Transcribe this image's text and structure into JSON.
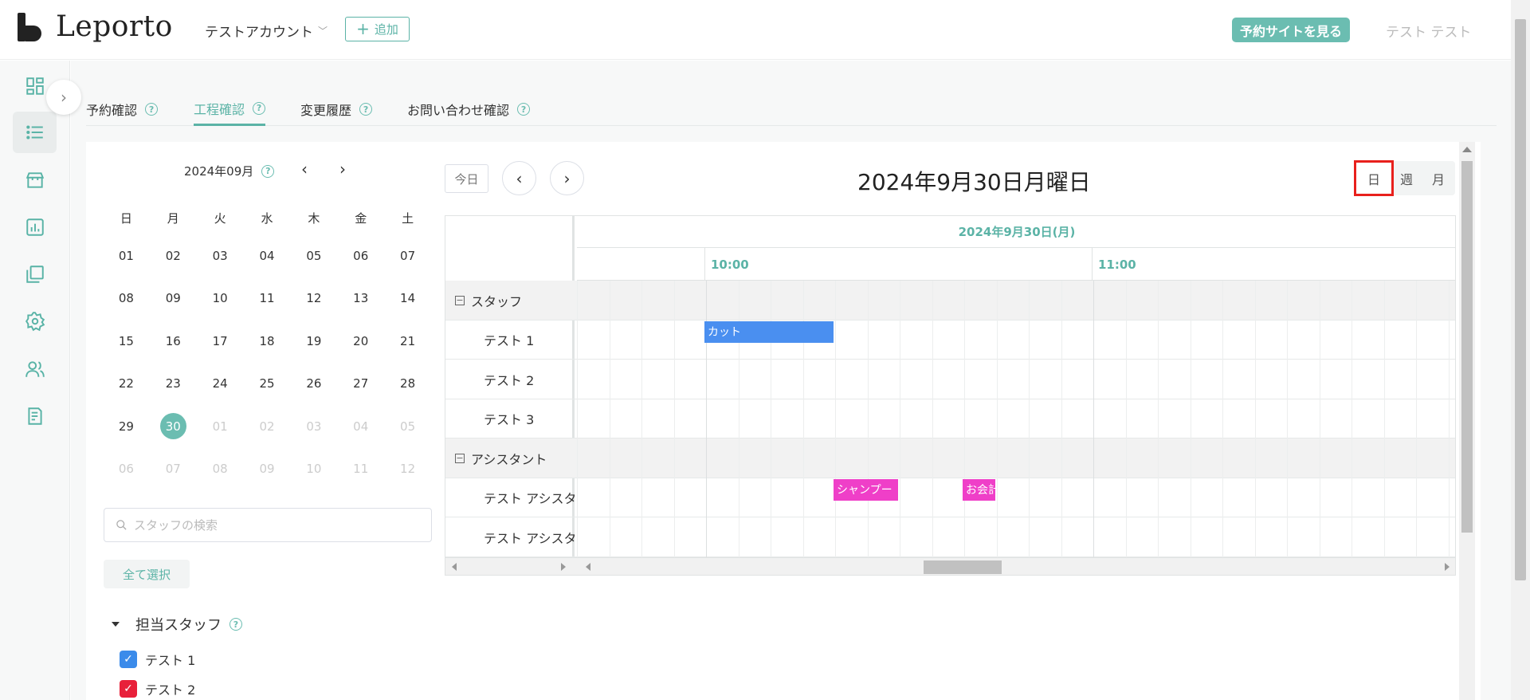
{
  "header": {
    "logo_text": "Leporto",
    "account_label": "テストアカウント",
    "add_label": "追加",
    "site_button_label": "予約サイトを見る",
    "user_name": "テスト テスト"
  },
  "sidebar": {
    "items": [
      {
        "icon": "dashboard-icon"
      },
      {
        "icon": "list-icon",
        "active": true
      },
      {
        "icon": "store-icon"
      },
      {
        "icon": "chart-icon"
      },
      {
        "icon": "copy-icon"
      },
      {
        "icon": "gear-icon"
      },
      {
        "icon": "users-icon"
      },
      {
        "icon": "report-icon"
      }
    ]
  },
  "tabs": [
    {
      "label": "予約確認"
    },
    {
      "label": "工程確認",
      "active": true
    },
    {
      "label": "変更履歴"
    },
    {
      "label": "お問い合わせ確認"
    }
  ],
  "mini_calendar": {
    "month_label": "2024年09月",
    "weekdays": [
      "日",
      "月",
      "火",
      "水",
      "木",
      "金",
      "土"
    ],
    "weeks": [
      [
        "01",
        "02",
        "03",
        "04",
        "05",
        "06",
        "07"
      ],
      [
        "08",
        "09",
        "10",
        "11",
        "12",
        "13",
        "14"
      ],
      [
        "15",
        "16",
        "17",
        "18",
        "19",
        "20",
        "21"
      ],
      [
        "22",
        "23",
        "24",
        "25",
        "26",
        "27",
        "28"
      ],
      [
        "29",
        "30",
        "01",
        "02",
        "03",
        "04",
        "05"
      ],
      [
        "06",
        "07",
        "08",
        "09",
        "10",
        "11",
        "12"
      ]
    ],
    "selected": "30"
  },
  "search": {
    "placeholder": "スタッフの検索"
  },
  "select_all_label": "全て選択",
  "staff_section": {
    "title": "担当スタッフ",
    "items": [
      {
        "label": "テスト 1",
        "color": "#3b8bea",
        "checked": true
      },
      {
        "label": "テスト 2",
        "color": "#e8203a",
        "checked": true
      }
    ]
  },
  "schedule": {
    "today_label": "今日",
    "title": "2024年9月30日月曜日",
    "views": [
      "日",
      "週",
      "月"
    ],
    "active_view": "日",
    "date_header": "2024年9月30日(月)",
    "times": [
      "10:00",
      "11:00"
    ],
    "rows": [
      {
        "type": "group",
        "label": "スタッフ"
      },
      {
        "type": "resource",
        "label": "テスト 1"
      },
      {
        "type": "resource",
        "label": "テスト 2"
      },
      {
        "type": "resource",
        "label": "テスト 3"
      },
      {
        "type": "group",
        "label": "アシスタント"
      },
      {
        "type": "resource",
        "label": "テスト アシスタント"
      },
      {
        "type": "resource",
        "label": "テスト アシスタント"
      }
    ],
    "events": [
      {
        "label": "カット",
        "row": 1,
        "start": "10:00",
        "end": "10:20",
        "color": "#4a8ff0"
      },
      {
        "label": "シャンプー",
        "row": 5,
        "start": "10:20",
        "end": "10:30",
        "color": "#ef3fc8"
      },
      {
        "label": "お会計",
        "row": 5,
        "start": "10:40",
        "end": "10:45",
        "color": "#ef3fc8"
      }
    ]
  }
}
